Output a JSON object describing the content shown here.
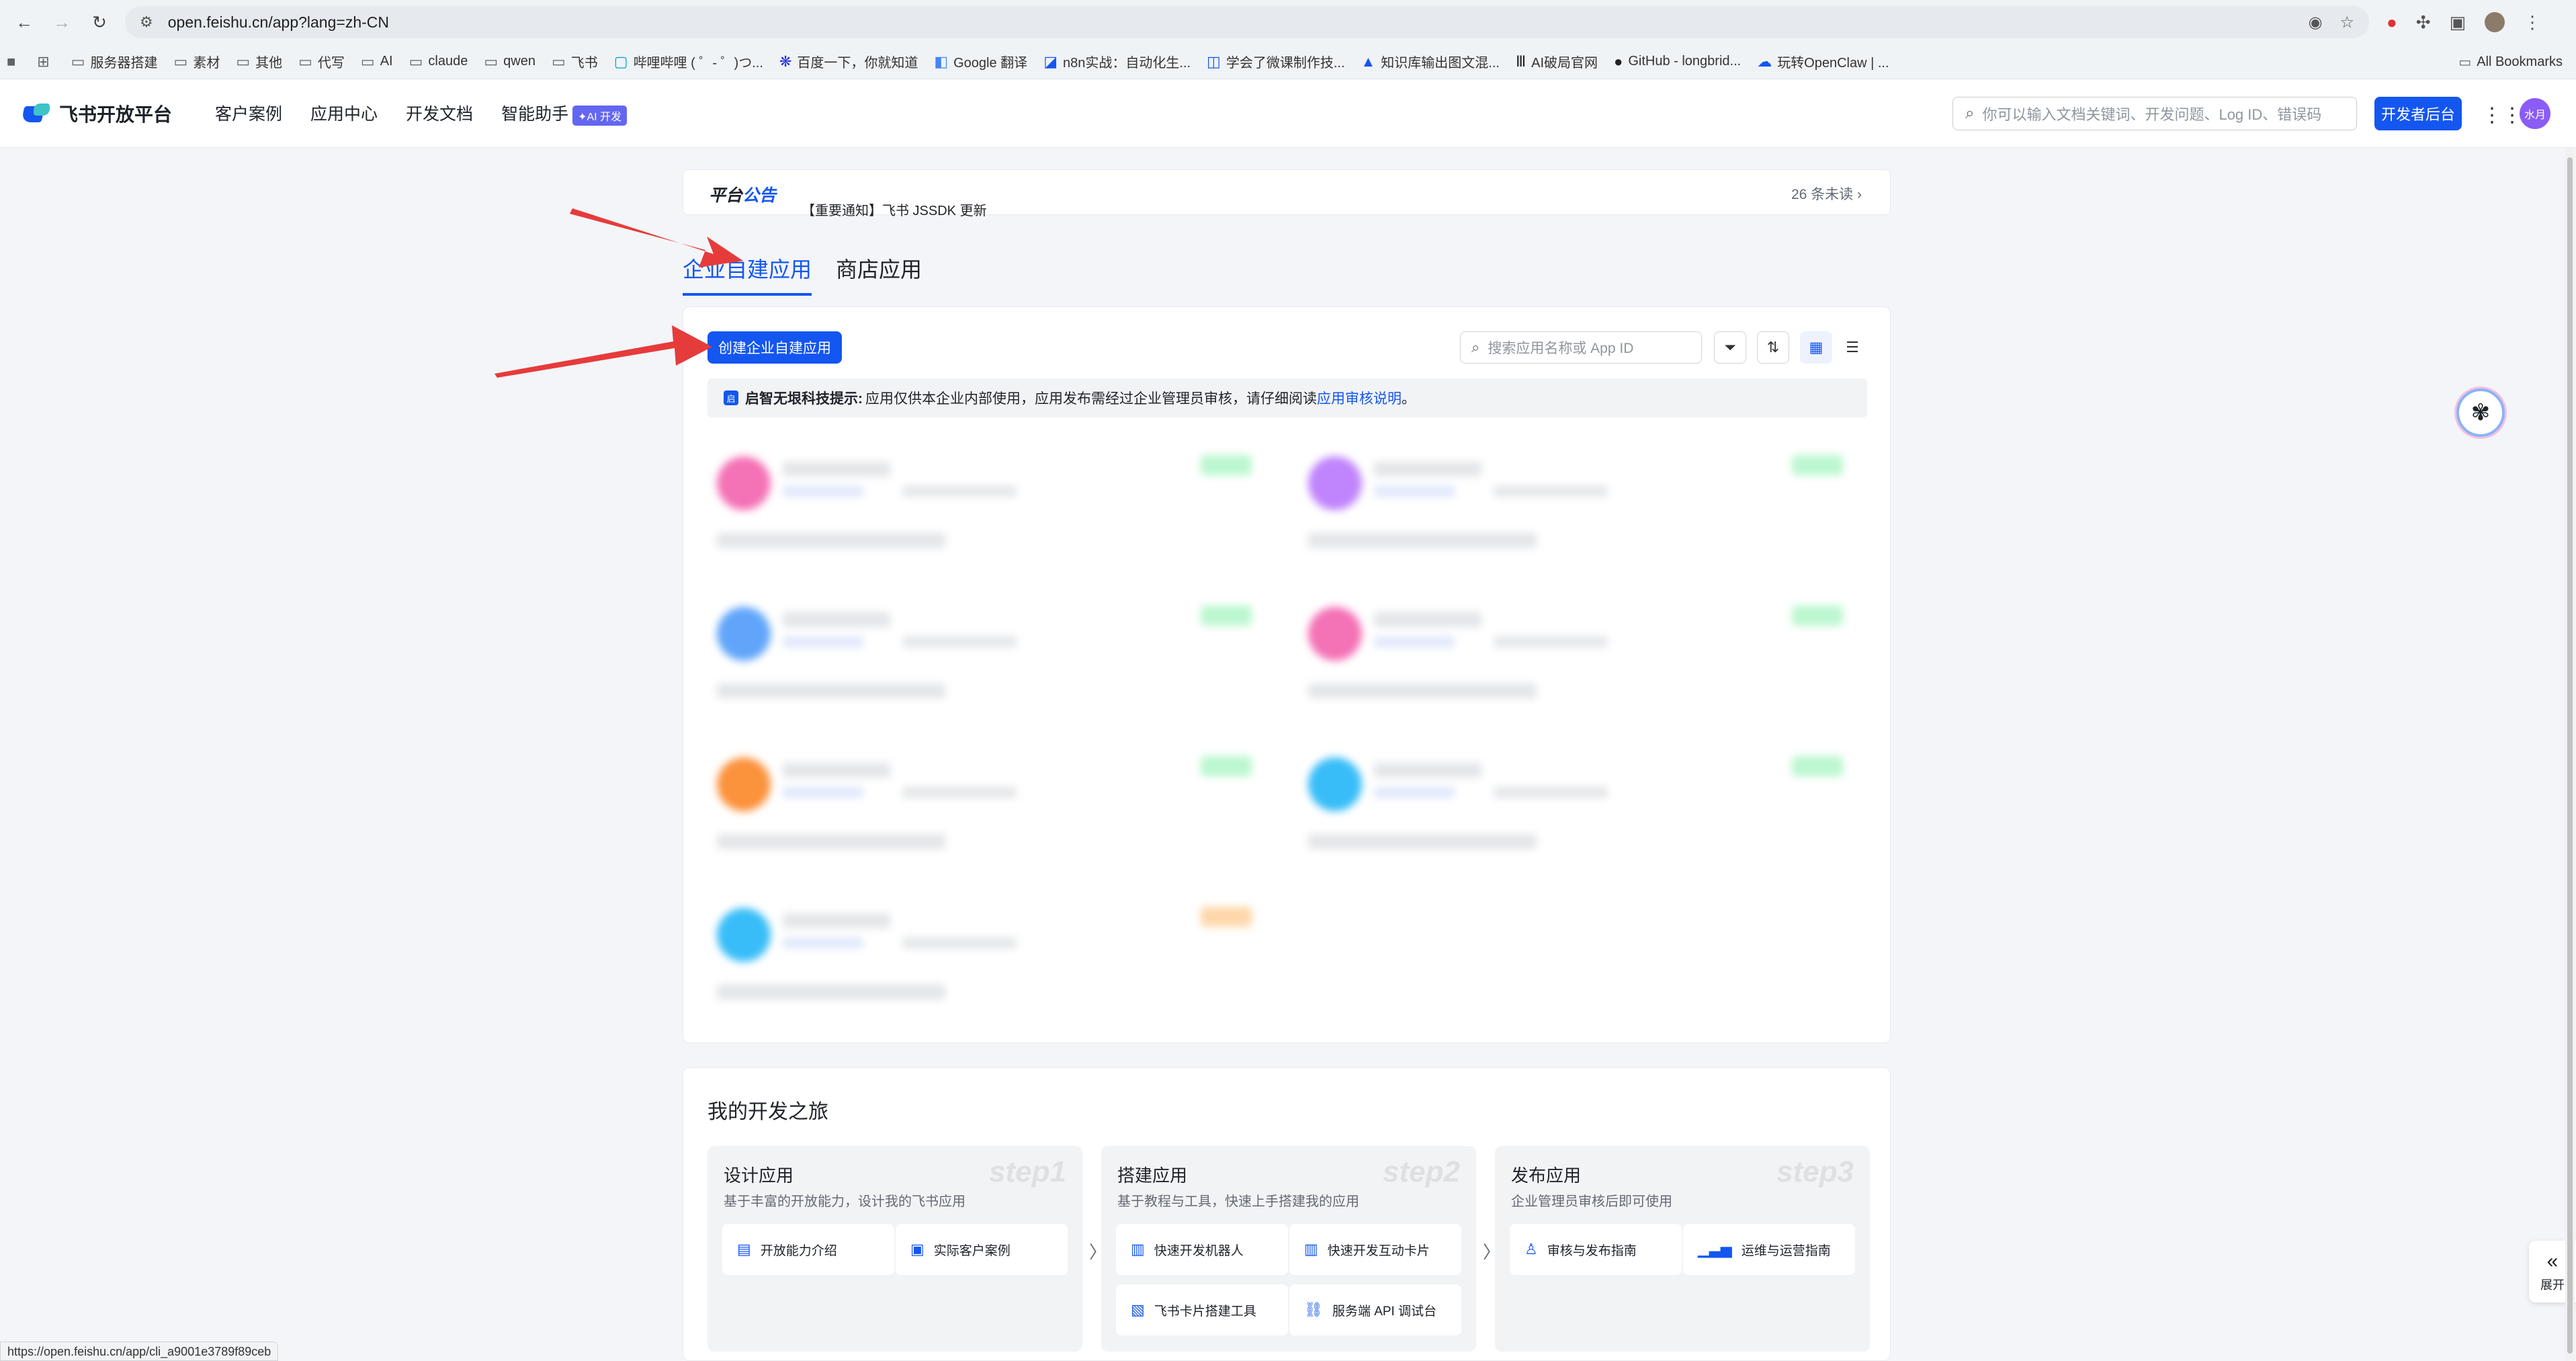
{
  "browser": {
    "url": "open.feishu.cn/app?lang=zh-CN",
    "bookmarks": [
      "服务器搭建",
      "素材",
      "其他",
      "代写",
      "AI",
      "claude",
      "qwen",
      "飞书",
      "哔哩哔哩 ( ゜- ゜)つ...",
      "百度一下，你就知道",
      "Google 翻译",
      "n8n实战：自动化生...",
      "学会了微课制作技...",
      "知识库输出图文混...",
      "AI破局官网",
      "GitHub - longbrid...",
      "玩转OpenClaw | ..."
    ],
    "all_bookmarks": "All Bookmarks",
    "status_url": "https://open.feishu.cn/app/cli_a9001e3789f89ceb"
  },
  "header": {
    "logo": "飞书开放平台",
    "nav": [
      "客户案例",
      "应用中心",
      "开发文档",
      "智能助手"
    ],
    "ai_badge": "✦AI 开发",
    "search_placeholder": "你可以输入文档关键词、开发问题、Log ID、错误码",
    "dev_button": "开发者后台",
    "avatar_text": "水月"
  },
  "notice": {
    "title_a": "平台",
    "title_b": "公告",
    "text": "【重要通知】飞书 JSSDK 更新",
    "unread": "26 条未读 ›"
  },
  "tabs": [
    "企业自建应用",
    "商店应用"
  ],
  "panel": {
    "create_button": "创建企业自建应用",
    "search_placeholder": "搜索应用名称或 App ID",
    "tip_bold": "启智无垠科技提示:",
    "tip_text": "应用仅供本企业内部使用，应用发布需经过企业管理员审核，请仔细阅读",
    "tip_link": "应用审核说明",
    "tip_end": "。"
  },
  "apps": [
    {
      "color": "#f472b6",
      "tag": "#bbf7d0"
    },
    {
      "color": "#c084fc",
      "tag": "#bbf7d0"
    },
    {
      "color": "#60a5fa",
      "tag": "#bbf7d0"
    },
    {
      "color": "#f472b6",
      "tag": "#bbf7d0"
    },
    {
      "color": "#fb923c",
      "tag": "#bbf7d0"
    },
    {
      "color": "#38bdf8",
      "tag": "#bbf7d0"
    },
    {
      "color": "#38bdf8",
      "tag": "#fed7aa"
    }
  ],
  "journey": {
    "title": "我的开发之旅",
    "steps": [
      {
        "name": "设计应用",
        "desc": "基于丰富的开放能力，设计我的飞书应用",
        "num": "step1",
        "links": [
          "开放能力介绍",
          "实际客户案例"
        ]
      },
      {
        "name": "搭建应用",
        "desc": "基于教程与工具，快速上手搭建我的应用",
        "num": "step2",
        "links": [
          "快速开发机器人",
          "快速开发互动卡片",
          "飞书卡片搭建工具",
          "服务端 API 调试台"
        ]
      },
      {
        "name": "发布应用",
        "desc": "企业管理员审核后即可使用",
        "num": "step3",
        "links": [
          "审核与发布指南",
          "运维与运营指南"
        ]
      }
    ]
  },
  "expand_label": "展开",
  "colors": {
    "accent": "#1456f0",
    "annotation_arrow": "#e63b3b"
  }
}
